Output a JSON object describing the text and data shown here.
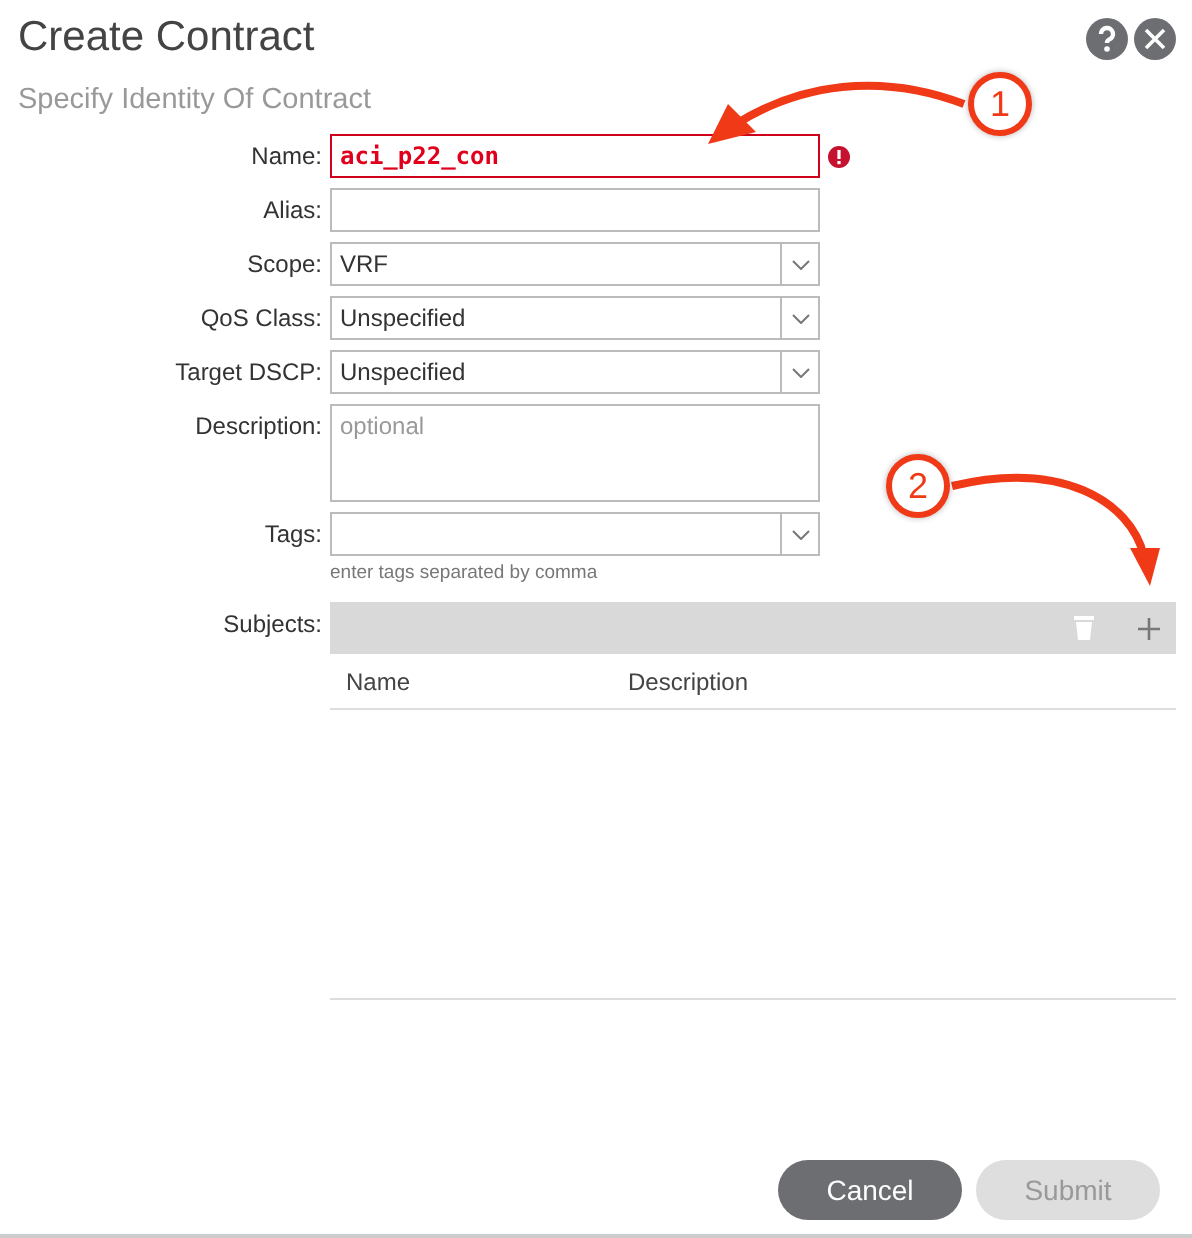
{
  "dialog": {
    "title": "Create Contract",
    "subtitle": "Specify Identity Of Contract"
  },
  "fields": [
    {
      "kind": "text",
      "label": "Name:",
      "value": "aci_p22_con",
      "error": true
    },
    {
      "kind": "text",
      "label": "Alias:"
    },
    {
      "kind": "select",
      "label": "Scope:",
      "value": "VRF"
    },
    {
      "kind": "select",
      "label": "QoS Class:",
      "value": "Unspecified"
    },
    {
      "kind": "select",
      "label": "Target DSCP:",
      "value": "Unspecified"
    },
    {
      "kind": "textarea",
      "label": "Description:",
      "placeholder": "optional"
    },
    {
      "kind": "select",
      "label": "Tags:",
      "hint": "enter tags separated by comma"
    }
  ],
  "subjects": {
    "label": "Subjects:",
    "columns": [
      "Name",
      "Description"
    ]
  },
  "buttons": [
    {
      "label": "Cancel",
      "disabled": false
    },
    {
      "label": "Submit",
      "disabled": true
    }
  ],
  "callouts": [
    {
      "number": "1"
    },
    {
      "number": "2"
    }
  ]
}
